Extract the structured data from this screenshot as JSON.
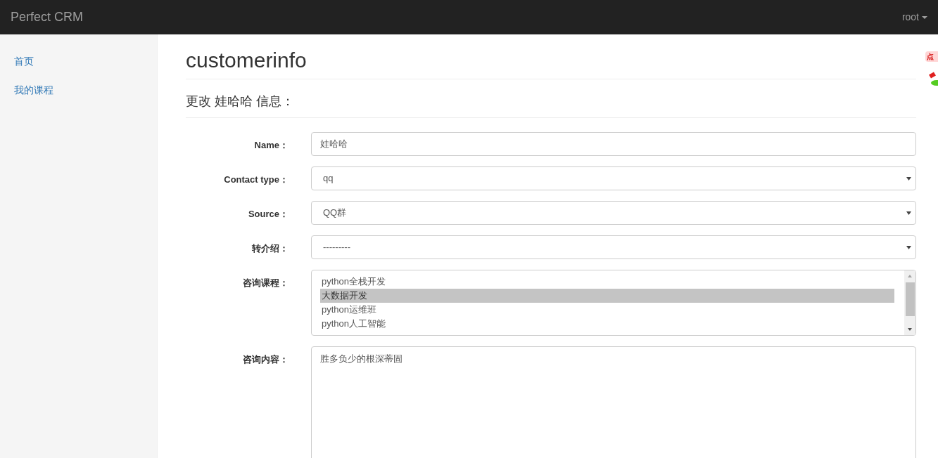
{
  "navbar": {
    "brand": "Perfect CRM",
    "user": "root"
  },
  "sidebar": {
    "items": [
      {
        "label": "首页"
      },
      {
        "label": "我的课程"
      }
    ]
  },
  "page": {
    "title": "customerinfo",
    "subtitle": "更改 娃哈哈 信息："
  },
  "form": {
    "fields": [
      {
        "kind": "input",
        "label": "Name：",
        "value": "娃哈哈"
      },
      {
        "kind": "select",
        "label": "Contact type：",
        "value": "qq"
      },
      {
        "kind": "select",
        "label": "Source：",
        "value": "QQ群"
      },
      {
        "kind": "select",
        "label": "转介绍：",
        "value": "---------"
      },
      {
        "kind": "multiselect",
        "label": "咨询课程：",
        "options": [
          {
            "label": "python全栈开发",
            "selected": false
          },
          {
            "label": "大数据开发",
            "selected": true
          },
          {
            "label": "python运维班",
            "selected": false
          },
          {
            "label": "python人工智能",
            "selected": false
          }
        ]
      },
      {
        "kind": "textarea",
        "label": "咨询内容：",
        "value": "胜多负少的根深蒂固"
      }
    ]
  },
  "floating_badge": {
    "text": "点"
  }
}
